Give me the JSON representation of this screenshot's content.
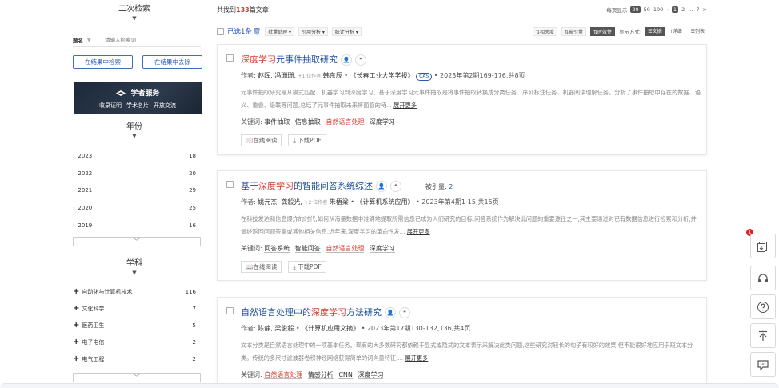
{
  "sidebar": {
    "secondary_search": "二次检索",
    "field_label": "题名",
    "field_placeholder": "请输入检索词",
    "btn_search_within": "在结果中检索",
    "btn_exclude": "在结果中去除",
    "banner": {
      "title": "学者服务",
      "items": [
        "收录证明",
        "学术名片",
        "开放交流"
      ]
    },
    "year_title": "年份",
    "years": [
      {
        "label": "2023",
        "count": "18"
      },
      {
        "label": "2022",
        "count": "20"
      },
      {
        "label": "2021",
        "count": "29"
      },
      {
        "label": "2020",
        "count": "25"
      },
      {
        "label": "2019",
        "count": "16"
      }
    ],
    "subject_title": "学科",
    "subjects": [
      {
        "label": "自动化与计算机技术",
        "count": "116"
      },
      {
        "label": "文化科学",
        "count": "7"
      },
      {
        "label": "医药卫生",
        "count": "5"
      },
      {
        "label": "电子电信",
        "count": "2"
      },
      {
        "label": "电气工程",
        "count": "2"
      }
    ],
    "more_glyph": "﹀"
  },
  "main": {
    "total_prefix": "共找到",
    "total_count": "133",
    "total_suffix": "篇文章",
    "page_size_label": "每页显示",
    "page_sizes": [
      "20",
      "50",
      "100"
    ],
    "pages": [
      "1",
      "2",
      "...",
      "7",
      ">"
    ],
    "selected_text": "已选1条",
    "dropdowns": [
      "批量处理 ▾",
      "引用分析 ▾",
      "统计分析 ▾"
    ],
    "sorts": [
      "相关度",
      "被引量",
      "时效性"
    ],
    "display_label": "显示方式:",
    "views": [
      "文摘",
      "详细",
      "列表"
    ]
  },
  "results": [
    {
      "title_pre": "",
      "title_hl": "深度学习",
      "title_post": "元事件抽取研究",
      "cited_label": "",
      "cited_value": "",
      "author_label": "作者:",
      "authors": "赵晖, 冯珊珊,",
      "more_authors": "+1 位作者",
      "last_author": "韩东辰",
      "journal": "《长春工业大学学报》",
      "badge": "CAS",
      "issue": "• 2023年第2期169-176,共8页",
      "abstract": "元事件抽取研究是从模式匹配、机器学习到深度学习。基于深度学习元事件抽取是将事件抽取转换成分类任务、序列标注任务、机器阅读理解任务。分析了事件抽取中存在的数据、语义、重叠、级联等问题,总结了元事件抽取未来将面临的待...",
      "expand": "展开更多",
      "kw_label": "关键词:",
      "keywords": [
        "事件抽取",
        "信息抽取",
        "自然语言处理",
        "深度学习"
      ],
      "kw_red": [
        false,
        false,
        true,
        false
      ],
      "read": "在线阅读",
      "download": "下载PDF"
    },
    {
      "title_pre": "基于",
      "title_hl": "深度学习",
      "title_post": "的智能问答系统综述",
      "cited_label": "被引量:",
      "cited_value": "2",
      "author_label": "作者:",
      "authors": "姚元杰, 龚毅光,",
      "more_authors": "+2 位作者",
      "last_author": "朱梧梁",
      "journal": "《计算机系统应用》",
      "badge": "",
      "issue": "• 2023年第4期1-15,共15页",
      "abstract": "在科技发达和信息爆炸的时代,如何从海量数据中准确地提取所需信息已成为人们研究的目标,问答系统作为解决此问题的重要途径之一,其主要通过对已有数据信息进行检索和分析,并最终返回问题答案或其他相关信息.近年来,深度学习的革命性发...",
      "expand": "展开更多",
      "kw_label": "关键词:",
      "keywords": [
        "问答系统",
        "智能问答",
        "自然语言处理",
        "深度学习"
      ],
      "kw_red": [
        false,
        false,
        true,
        false
      ],
      "read": "在线阅读",
      "download": "下载PDF"
    },
    {
      "title_pre": "自然语言处理中的",
      "title_hl": "深度学习",
      "title_post": "方法研究",
      "cited_label": "",
      "cited_value": "",
      "author_label": "作者:",
      "authors": "陈静, 梁俊毅",
      "more_authors": "",
      "last_author": "",
      "journal": "《计算机应用文摘》",
      "badge": "",
      "issue": "• 2023年第17期130-132,136,共4页",
      "abstract": "文本分类是自然语言处理中的一项基本任务。现有的大多数研究都依赖于显式或隐式的文本表示来解决此类问题,这些研究对较长的句子有较好的效果,但不能很好地应用于短文本分类。传统的多尺寸滤波器卷积神经网络获得简单的词向量特征,...",
      "expand": "展开更多",
      "kw_label": "关键词:",
      "keywords": [
        "自然语言处理",
        "情感分析",
        "CNN",
        "深度学习"
      ],
      "kw_red": [
        true,
        false,
        false,
        false
      ],
      "read": "在线阅读",
      "download": "下载PDF"
    }
  ],
  "float": {
    "badge": "1"
  },
  "colors": {
    "accent": "#2a5ab3",
    "highlight": "#d23b2d",
    "title": "#1f4e9c"
  }
}
